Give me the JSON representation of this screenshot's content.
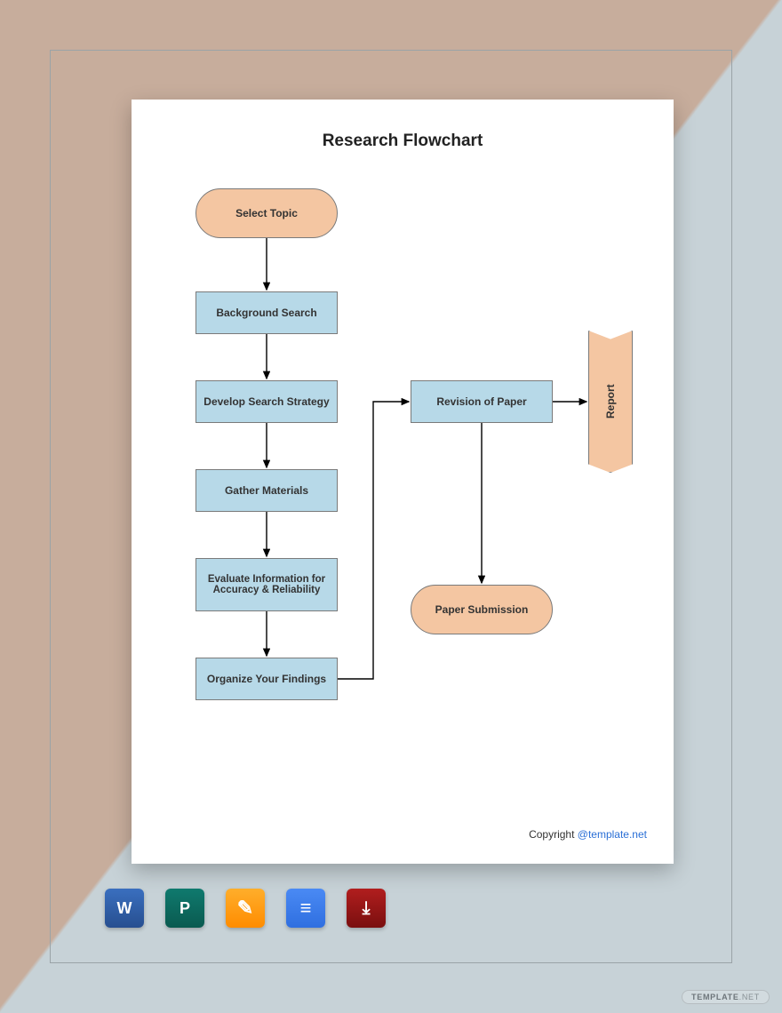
{
  "title": "Research Flowchart",
  "nodes": {
    "select_topic": "Select Topic",
    "background_search": "Background Search",
    "develop_strategy": "Develop Search Strategy",
    "gather_materials": "Gather Materials",
    "evaluate_info": "Evaluate Information for Accuracy & Reliability",
    "organize_findings": "Organize Your Findings",
    "revision_paper": "Revision of Paper",
    "paper_submission": "Paper Submission",
    "report": "Report"
  },
  "copyright": {
    "label": "Copyright ",
    "link": "@template.net"
  },
  "apps": {
    "word": "Microsoft Word",
    "publisher": "Microsoft Publisher",
    "pages": "Apple Pages",
    "docs": "Google Docs",
    "pdf": "Adobe PDF"
  },
  "watermark": {
    "a": "TEMPLATE",
    "b": ".NET"
  }
}
